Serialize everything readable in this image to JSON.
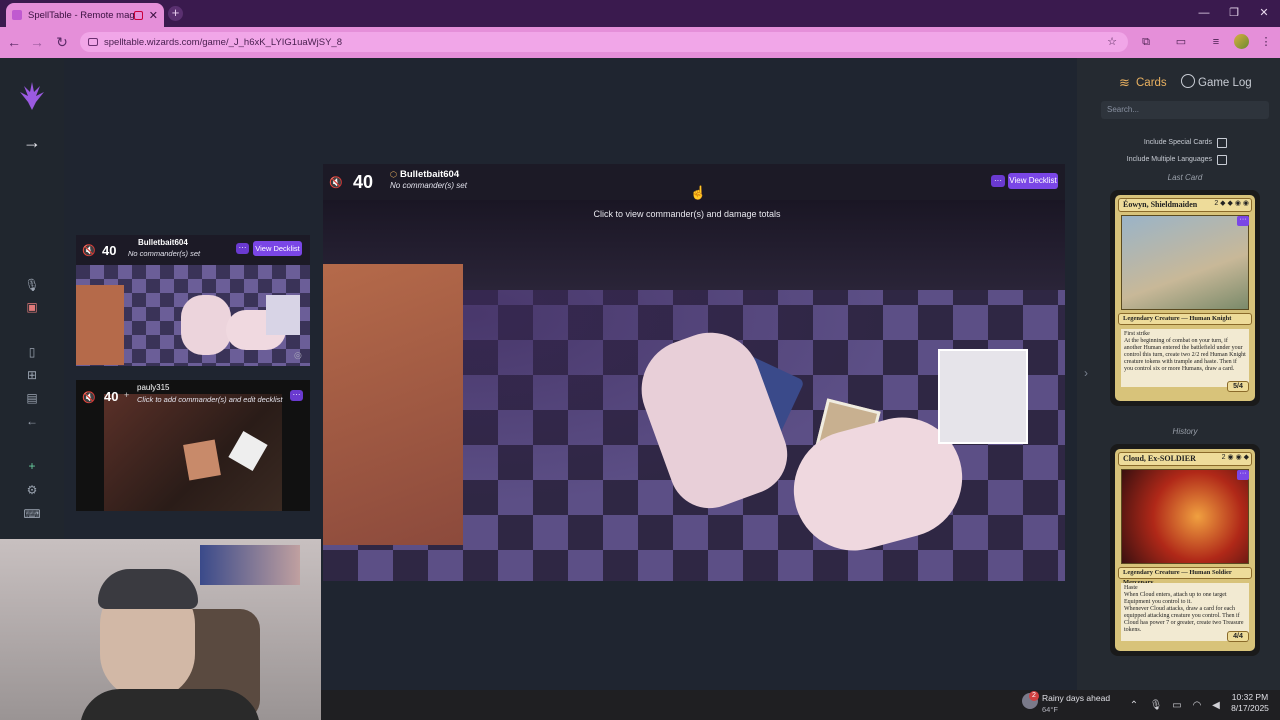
{
  "browser": {
    "tab_title": "SpellTable - Remote magic",
    "tab_close": "✕",
    "new_tab": "+",
    "url": "spelltable.wizards.com/game/_J_h6xK_LYIG1uaWjSY_8",
    "window_controls": {
      "minimize": "—",
      "restore": "❐",
      "close": "✕"
    }
  },
  "rail": {
    "expand_arrow": "→"
  },
  "main_player": {
    "life": "40",
    "name": "Bulletbait604",
    "commander": "No commander(s) set",
    "menu": "···",
    "decklist_button": "View Decklist",
    "tooltip": "Click to view commander(s) and damage totals"
  },
  "small_players": [
    {
      "life": "40",
      "name": "Bulletbait604",
      "commander": "No commander(s) set",
      "menu": "···",
      "decklist_button": "View Decklist"
    },
    {
      "life": "40",
      "name": "pauly315",
      "commander": "Click to add commander(s) and edit decklist",
      "menu": "···"
    }
  ],
  "right_panel": {
    "tab_cards": "Cards",
    "tab_log": "Game Log",
    "search_placeholder": "Search...",
    "include_special": "Include Special Cards",
    "include_languages": "Include Multiple Languages",
    "last_card_label": "Last Card",
    "history_label": "History",
    "last_card": {
      "name": "Éowyn, Shieldmaiden",
      "mana": "2 ◆ ◆ ◉ ◉",
      "type": "Legendary Creature — Human Knight",
      "text": "First strike\nAt the beginning of combat on your turn, if another Human entered the battlefield under your control this turn, create two 2/2 red Human Knight creature tokens with trample and haste. Then if you control six or more Humans, draw a card.",
      "pt": "5/4"
    },
    "history_card": {
      "name": "Cloud, Ex-SOLDIER",
      "mana": "2 ◉ ◉ ◆",
      "type": "Legendary Creature — Human Soldier Mercenary",
      "text": "Haste\nWhen Cloud enters, attach up to one target Equipment you control to it.\nWhenever Cloud attacks, draw a card for each equipped attacking creature you control. Then if Cloud has power 7 or greater, create two Treasure tokens.",
      "pt": "4/4"
    }
  },
  "taskbar": {
    "weather_title": "Rainy days ahead",
    "weather_temp": "64°F",
    "weather_badge": "2",
    "time": "10:32 PM",
    "date": "8/17/2025"
  },
  "colors": {
    "accent_purple": "#7a46e6",
    "browser_pink": "#e58fd9",
    "rail_bg": "#20262e",
    "panel_bg": "#252a31",
    "card_gold": "#d8c37a"
  }
}
